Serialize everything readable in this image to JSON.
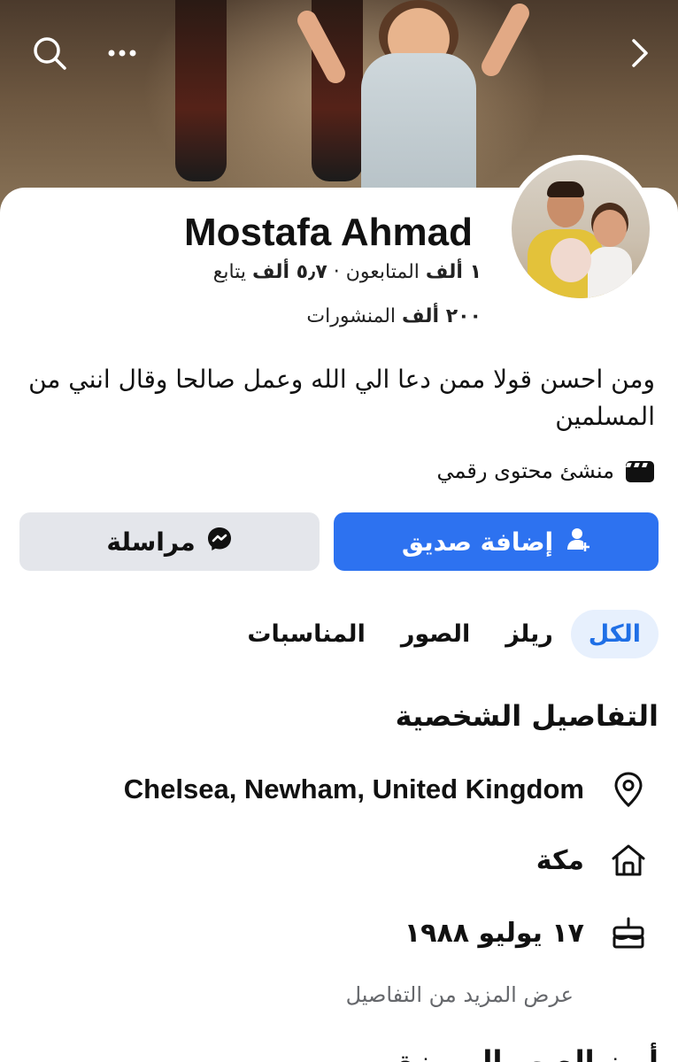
{
  "profile": {
    "name": "Mostafa Ahmad",
    "stats_line": "١ ألف المتابعون · ٥٫٧ ألف يتابع",
    "followers_count": "١ ألف",
    "followers_label": "المتابعون",
    "following_count": "٥٫٧ ألف",
    "following_label": "يتابع",
    "posts_count": "٢٠٠ ألف",
    "posts_label": "المنشورات",
    "bio": "ومن احسن قولا ممن دعا الي الله وعمل صالحا وقال انني من المسلمين",
    "category": "منشئ محتوى رقمي"
  },
  "actions": {
    "add_friend": "إضافة صديق",
    "message": "مراسلة"
  },
  "tabs": [
    {
      "label": "الكل",
      "active": true
    },
    {
      "label": "ريلز",
      "active": false
    },
    {
      "label": "الصور",
      "active": false
    },
    {
      "label": "المناسبات",
      "active": false
    }
  ],
  "details": {
    "title": "التفاصيل الشخصية",
    "location": "Chelsea, Newham, United Kingdom",
    "hometown": "مكة",
    "birthday": "١٧ يوليو ١٩٨٨",
    "see_more": "عرض المزيد من التفاصيل",
    "next_section": "أبرز الصور المميزة"
  },
  "icons": {
    "search": "search-icon",
    "more": "more-icon",
    "back": "chevron-right-icon",
    "category": "clapperboard-icon",
    "add_friend": "add-person-icon",
    "message": "messenger-icon",
    "location": "location-pin-icon",
    "hometown": "home-icon",
    "birthday": "cake-icon"
  },
  "colors": {
    "primary": "#2d72f0",
    "tab_active_bg": "#e7f0fd",
    "tab_active_text": "#1f6fe6",
    "secondary_button": "#e4e6eb",
    "muted_text": "#65676b"
  }
}
